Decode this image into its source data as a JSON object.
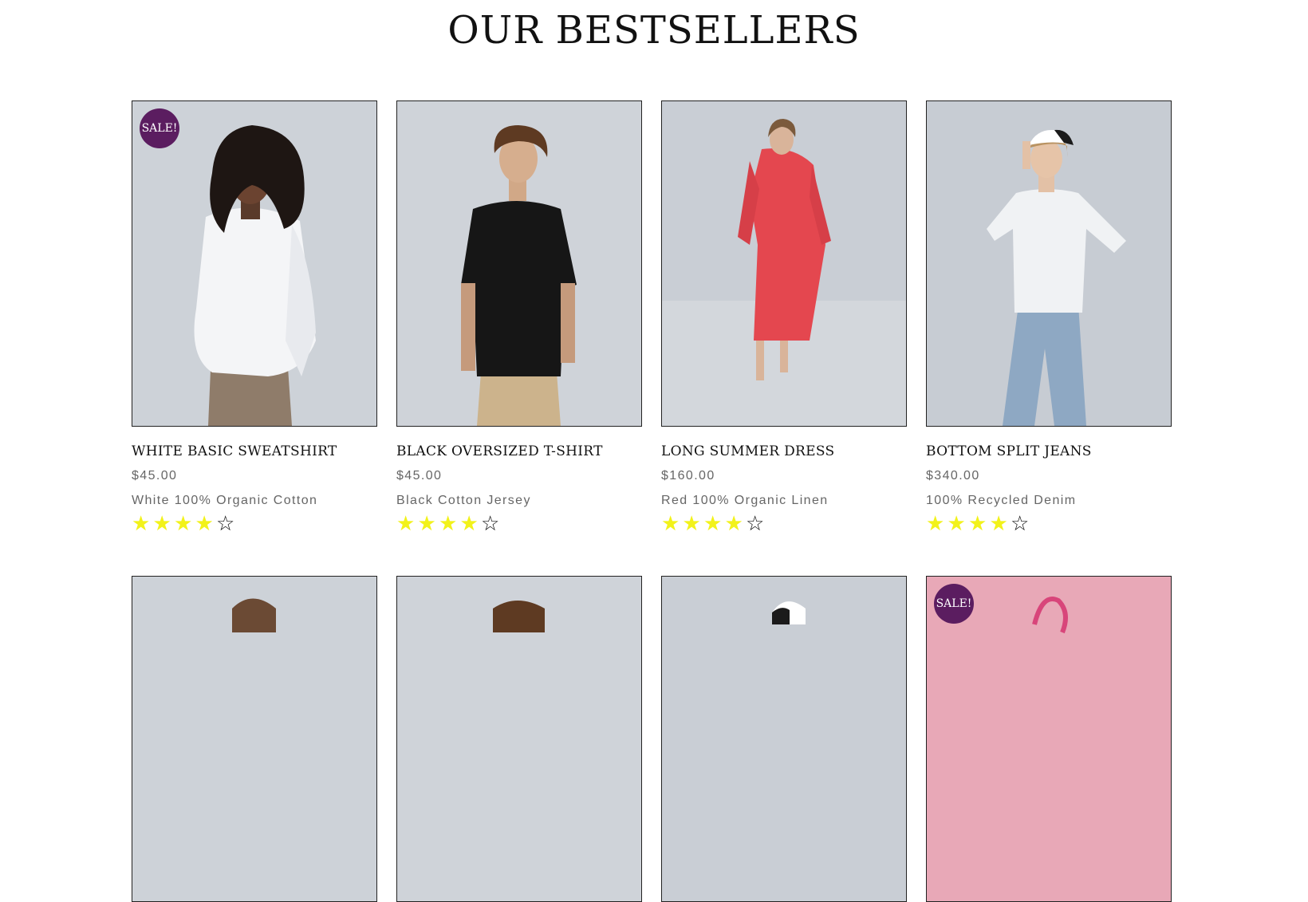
{
  "section": {
    "title": "OUR BESTSELLERS"
  },
  "colors": {
    "sale_badge": "#5b1d60",
    "star_filled": "#f2f21a",
    "photo_bg": "#ccd1d8"
  },
  "products": [
    {
      "name": "WHITE BASIC SWEATSHIRT",
      "price": "$45.00",
      "description": "White 100% Organic Cotton",
      "sale": true,
      "badge": "SALE!",
      "rating": 4,
      "rating_max": 5
    },
    {
      "name": "BLACK OVERSIZED T-SHIRT",
      "price": "$45.00",
      "description": "Black Cotton Jersey",
      "sale": false,
      "rating": 4,
      "rating_max": 5
    },
    {
      "name": "LONG SUMMER DRESS",
      "price": "$160.00",
      "description": "Red 100% Organic Linen",
      "sale": false,
      "rating": 4,
      "rating_max": 5
    },
    {
      "name": "BOTTOM SPLIT JEANS",
      "price": "$340.00",
      "description": "100% Recycled Denim",
      "sale": false,
      "rating": 4,
      "rating_max": 5
    }
  ],
  "next_row": [
    {
      "sale": false
    },
    {
      "sale": false
    },
    {
      "sale": false
    },
    {
      "sale": true,
      "badge": "SALE!"
    }
  ]
}
